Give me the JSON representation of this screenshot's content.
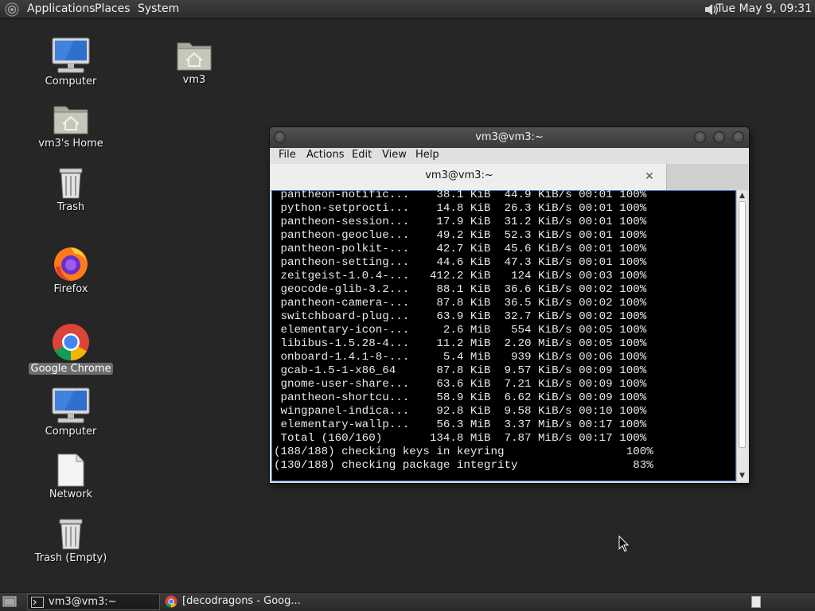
{
  "top_panel": {
    "menus": [
      "Applications",
      "Places",
      "System"
    ],
    "clock": "Tue May  9, 09:31"
  },
  "desktop_icons": [
    {
      "label": "Computer",
      "icon": "computer-icon"
    },
    {
      "label": "vm3",
      "icon": "home-folder-icon"
    },
    {
      "label": "vm3's Home",
      "icon": "home-folder-icon"
    },
    {
      "label": "Trash",
      "icon": "trash-icon"
    },
    {
      "label": "Firefox",
      "icon": "firefox-icon"
    },
    {
      "label": "Google Chrome",
      "icon": "chrome-icon",
      "selected": true
    },
    {
      "label": "Computer",
      "icon": "computer-icon"
    },
    {
      "label": "Network",
      "icon": "document-icon"
    },
    {
      "label": "Trash (Empty)",
      "icon": "trash-icon"
    }
  ],
  "terminal_window": {
    "title": "vm3@vm3:~",
    "menu": [
      "File",
      "Actions",
      "Edit",
      "View",
      "Help"
    ],
    "tab_title": "vm3@vm3:~",
    "lines": [
      " pantheon-notific...    38.1 KiB  44.9 KiB/s 00:01 100%",
      " python-setprocti...    14.8 KiB  26.3 KiB/s 00:01 100%",
      " pantheon-session...    17.9 KiB  31.2 KiB/s 00:01 100%",
      " pantheon-geoclue...    49.2 KiB  52.3 KiB/s 00:01 100%",
      " pantheon-polkit-...    42.7 KiB  45.6 KiB/s 00:01 100%",
      " pantheon-setting...    44.6 KiB  47.3 KiB/s 00:01 100%",
      " zeitgeist-1.0.4-...   412.2 KiB   124 KiB/s 00:03 100%",
      " geocode-glib-3.2...    88.1 KiB  36.6 KiB/s 00:02 100%",
      " pantheon-camera-...    87.8 KiB  36.5 KiB/s 00:02 100%",
      " switchboard-plug...    63.9 KiB  32.7 KiB/s 00:02 100%",
      " elementary-icon-...     2.6 MiB   554 KiB/s 00:05 100%",
      " libibus-1.5.28-4...    11.2 MiB  2.20 MiB/s 00:05 100%",
      " onboard-1.4.1-8-...     5.4 MiB   939 KiB/s 00:06 100%",
      " gcab-1.5-1-x86_64      87.8 KiB  9.57 KiB/s 00:09 100%",
      " gnome-user-share...    63.6 KiB  7.21 KiB/s 00:09 100%",
      " pantheon-shortcu...    58.9 KiB  6.62 KiB/s 00:09 100%",
      " wingpanel-indica...    92.8 KiB  9.58 KiB/s 00:10 100%",
      " elementary-wallp...    56.3 MiB  3.37 MiB/s 00:17 100%",
      " Total (160/160)       134.8 MiB  7.87 MiB/s 00:17 100%",
      "(188/188) checking keys in keyring                  100%",
      "(130/188) checking package integrity                 83%"
    ]
  },
  "taskbar": {
    "items": [
      {
        "label": "vm3@vm3:~",
        "icon": "terminal-icon",
        "active": true
      },
      {
        "label": "[decodragons - Goog...",
        "icon": "chrome-icon",
        "active": false
      }
    ]
  }
}
